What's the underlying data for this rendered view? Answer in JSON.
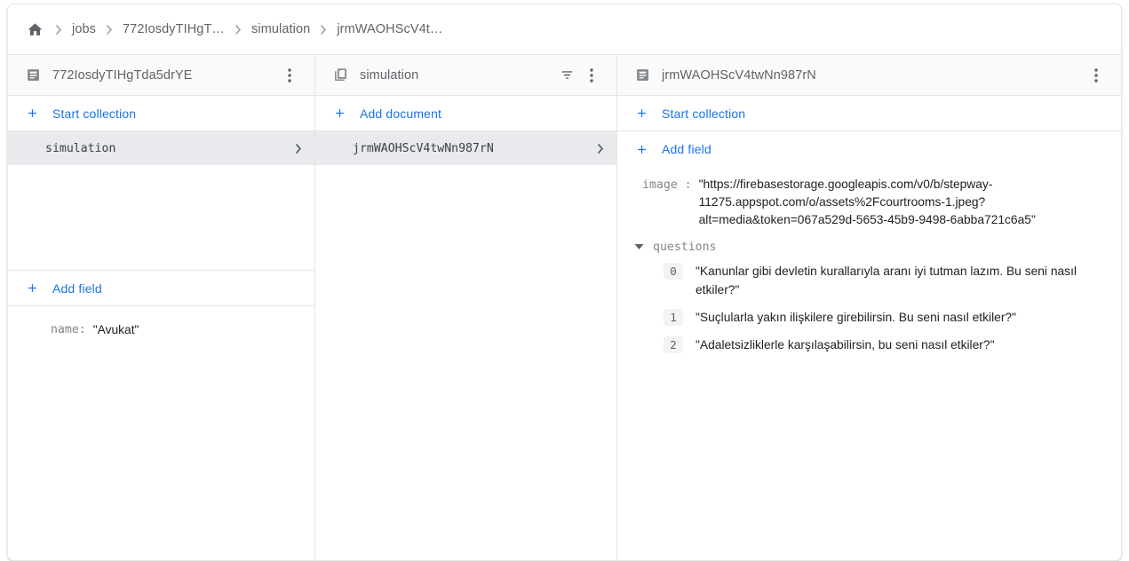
{
  "breadcrumb": {
    "home_icon": "home-icon",
    "items": [
      {
        "label": "jobs"
      },
      {
        "label": "772IosdyTIHgT…"
      },
      {
        "label": "simulation"
      },
      {
        "label": "jrmWAOHScV4t…"
      }
    ],
    "separator": "›"
  },
  "panel1": {
    "icon": "document-icon",
    "title": "772IosdyTIHgTda5drYE",
    "menu_icon": "more-vert-icon",
    "start_collection_label": "Start collection",
    "collections": [
      {
        "name": "simulation",
        "selected": true
      }
    ],
    "add_field_label": "Add field",
    "fields": [
      {
        "key": "name",
        "value": "\"Avukat\""
      }
    ]
  },
  "panel2": {
    "icon": "collection-icon",
    "title": "simulation",
    "filter_icon": "filter-icon",
    "menu_icon": "more-vert-icon",
    "add_document_label": "Add document",
    "documents": [
      {
        "name": "jrmWAOHScV4twNn987rN",
        "selected": true
      }
    ]
  },
  "panel3": {
    "icon": "document-icon",
    "title": "jrmWAOHScV4twNn987rN",
    "menu_icon": "more-vert-icon",
    "start_collection_label": "Start collection",
    "add_field_label": "Add field",
    "fields": [
      {
        "key": "image",
        "value": "\"https://firebasestorage.googleapis.com/v0/b/stepway-11275.appspot.com/o/assets%2Fcourtrooms-1.jpeg?alt=media&token=067a529d-5653-45b9-9498-6abba721c6a5\""
      }
    ],
    "array_field": {
      "name": "questions",
      "expanded": true,
      "caret_icon": "caret-down-icon",
      "items": [
        {
          "index": "0",
          "value": "\"Kanunlar gibi devletin kurallarıyla aranı iyi tutman lazım. Bu seni nasıl etkiler?\""
        },
        {
          "index": "1",
          "value": "\"Suçlularla yakın ilişkilere girebilirsin. Bu seni nasıl etkiler?\""
        },
        {
          "index": "2",
          "value": "\"Adaletsizliklerle karşılaşabilirsin, bu seni nasıl etkiler?\""
        }
      ]
    }
  },
  "colors": {
    "accent": "#1a73e8",
    "text_primary": "#202124",
    "text_secondary": "#5f6368",
    "selected_row": "#e8eaed",
    "header_bg": "#fafafa",
    "border": "#e5e5e5"
  }
}
